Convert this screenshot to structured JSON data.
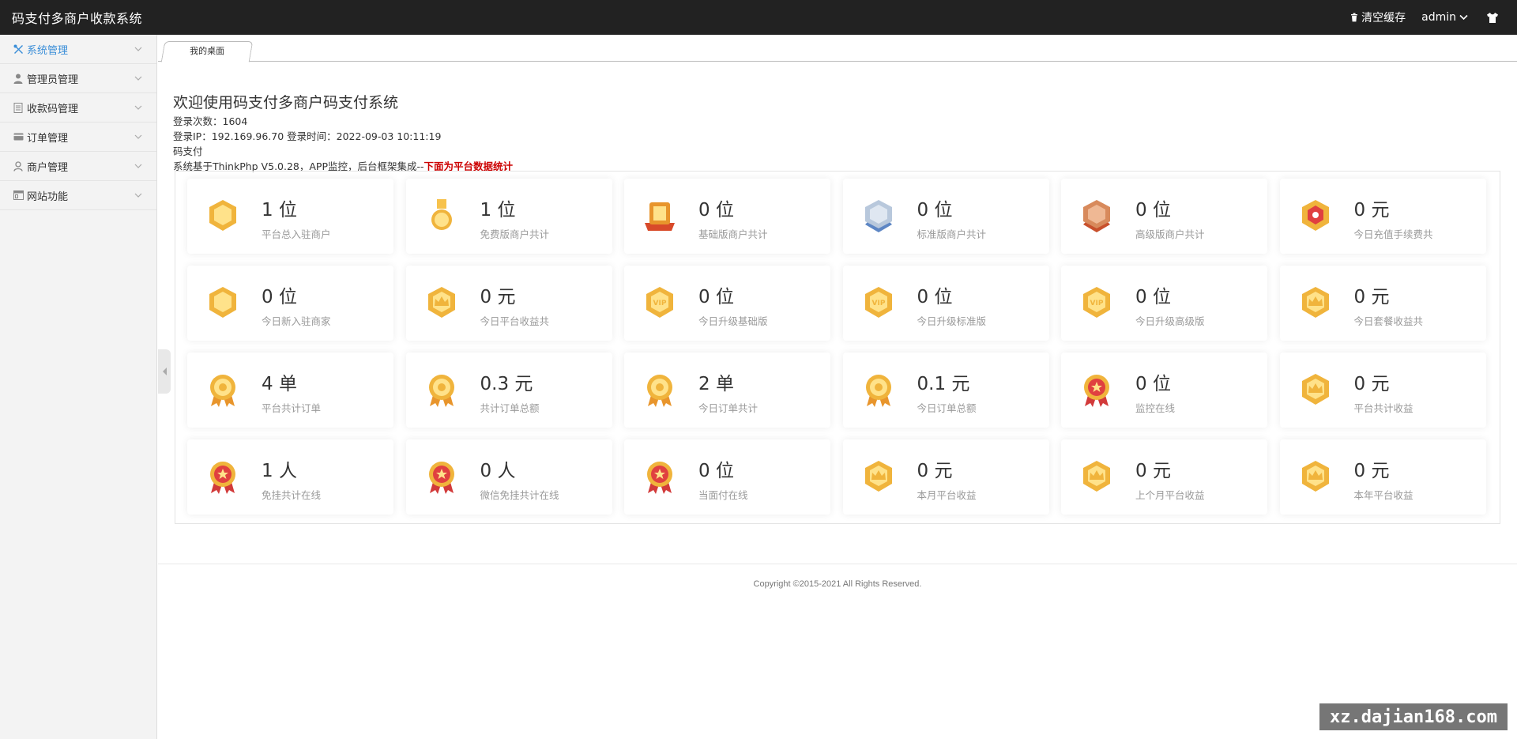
{
  "header": {
    "brand": "码支付多商户收款系统",
    "clear_cache": "清空缓存",
    "user": "admin"
  },
  "sidebar": {
    "items": [
      {
        "label": "系统管理",
        "icon": "tools-icon",
        "active": true
      },
      {
        "label": "管理员管理",
        "icon": "user-icon",
        "active": false
      },
      {
        "label": "收款码管理",
        "icon": "document-icon",
        "active": false
      },
      {
        "label": "订单管理",
        "icon": "card-icon",
        "active": false
      },
      {
        "label": "商户管理",
        "icon": "merchant-icon",
        "active": false
      },
      {
        "label": "网站功能",
        "icon": "window-icon",
        "active": false
      }
    ]
  },
  "tabs": [
    {
      "label": "我的桌面"
    }
  ],
  "welcome": {
    "title": "欢迎使用码支付多商户码支付系统",
    "login_count": "登录次数：1604",
    "login_info": "登录IP：192.169.96.70 登录时间：2022-09-03 10:11:19",
    "product": "码支付",
    "framework": "系统基于ThinkPhp V5.0.28，APP监控，后台框架集成--",
    "framework_highlight": "下面为平台数据统计"
  },
  "stats": [
    {
      "value": "1 位",
      "label": "平台总入驻商户",
      "badge": "medal-gold-hex",
      "color": "#f0b43c"
    },
    {
      "value": "1 位",
      "label": "免费版商户共计",
      "badge": "medal-ribbon",
      "color": "#f0b43c"
    },
    {
      "value": "0 位",
      "label": "基础版商户共计",
      "badge": "medal-red-ribbon",
      "color": "#e8952c"
    },
    {
      "value": "0 位",
      "label": "标准版商户共计",
      "badge": "medal-silver",
      "color": "#8fa8c8"
    },
    {
      "value": "0 位",
      "label": "高级版商户共计",
      "badge": "medal-bronze",
      "color": "#d88a5c"
    },
    {
      "value": "0 元",
      "label": "今日充值手续费共",
      "badge": "medal-gold-red",
      "color": "#f0b43c"
    },
    {
      "value": "0 位",
      "label": "今日新入驻商家",
      "badge": "medal-gold-hex",
      "color": "#f0b43c"
    },
    {
      "value": "0 元",
      "label": "今日平台收益共",
      "badge": "medal-crown",
      "color": "#f0b43c"
    },
    {
      "value": "0 位",
      "label": "今日升级基础版",
      "badge": "medal-vip",
      "color": "#f0b43c"
    },
    {
      "value": "0 位",
      "label": "今日升级标准版",
      "badge": "medal-vip",
      "color": "#f0b43c"
    },
    {
      "value": "0 位",
      "label": "今日升级高级版",
      "badge": "medal-vip",
      "color": "#f0b43c"
    },
    {
      "value": "0 元",
      "label": "今日套餐收益共",
      "badge": "medal-crown",
      "color": "#f0b43c"
    },
    {
      "value": "4 单",
      "label": "平台共计订单",
      "badge": "medal-round",
      "color": "#f0b43c"
    },
    {
      "value": "0.3 元",
      "label": "共计订单总额",
      "badge": "medal-round",
      "color": "#f0b43c"
    },
    {
      "value": "2 单",
      "label": "今日订单共计",
      "badge": "medal-round",
      "color": "#f0b43c"
    },
    {
      "value": "0.1 元",
      "label": "今日订单总额",
      "badge": "medal-round",
      "color": "#f0b43c"
    },
    {
      "value": "0 位",
      "label": "监控在线",
      "badge": "medal-red-star",
      "color": "#e04040"
    },
    {
      "value": "0 元",
      "label": "平台共计收益",
      "badge": "medal-crown",
      "color": "#f0b43c"
    },
    {
      "value": "1 人",
      "label": "免挂共计在线",
      "badge": "medal-red-star",
      "color": "#e04040"
    },
    {
      "value": "0 人",
      "label": "微信免挂共计在线",
      "badge": "medal-red-star",
      "color": "#e04040"
    },
    {
      "value": "0 位",
      "label": "当面付在线",
      "badge": "medal-red-star",
      "color": "#e04040"
    },
    {
      "value": "0 元",
      "label": "本月平台收益",
      "badge": "medal-crown",
      "color": "#f0b43c"
    },
    {
      "value": "0 元",
      "label": "上个月平台收益",
      "badge": "medal-crown",
      "color": "#f0b43c"
    },
    {
      "value": "0 元",
      "label": "本年平台收益",
      "badge": "medal-crown",
      "color": "#f0b43c"
    }
  ],
  "footer": {
    "copyright": "Copyright ©2015-2021 All Rights Reserved."
  },
  "watermark": "xz.dajian168.com"
}
